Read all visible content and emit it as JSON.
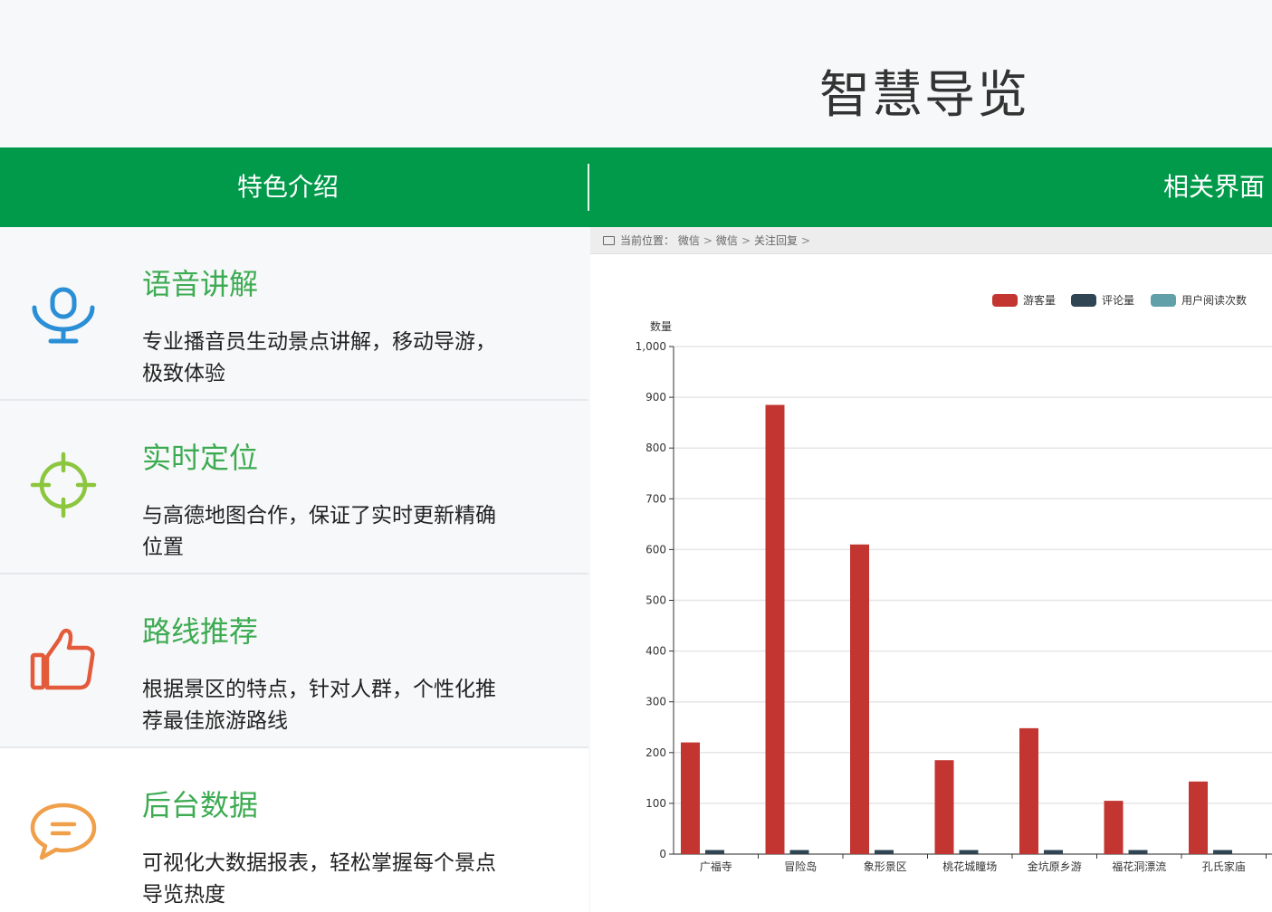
{
  "header": {
    "title": "智慧导览"
  },
  "tabs": [
    {
      "label": "特色介绍"
    },
    {
      "label": "相关界面"
    }
  ],
  "features": [
    {
      "title": "语音讲解",
      "desc": "专业播音员生动景点讲解，移动导游，极致体验",
      "icon": "microphone-icon",
      "color": "#2a8fd6"
    },
    {
      "title": "实时定位",
      "desc": "与高德地图合作，保证了实时更新精确位置",
      "icon": "crosshair-icon",
      "color": "#8cc63f"
    },
    {
      "title": "路线推荐",
      "desc": "根据景区的特点，针对人群，个性化推荐最佳旅游路线",
      "icon": "thumbs-up-icon",
      "color": "#e35b3b"
    },
    {
      "title": "后台数据",
      "desc": "可视化大数据报表，轻松掌握每个景点导览热度",
      "icon": "chat-bubble-icon",
      "color": "#f0a04b"
    }
  ],
  "breadcrumb": {
    "prefix": "当前位置：",
    "items": [
      "微信",
      "微信",
      "关注回复"
    ],
    "separator": ">"
  },
  "chart_data": {
    "type": "bar",
    "ylabel": "数量",
    "ylim": [
      0,
      1000
    ],
    "yticks": [
      0,
      100,
      200,
      300,
      400,
      500,
      600,
      700,
      800,
      900,
      1000
    ],
    "ytick_labels": [
      "0",
      "100",
      "200",
      "300",
      "400",
      "500",
      "600",
      "700",
      "800",
      "900",
      "1,000"
    ],
    "grid": true,
    "legend_position": "top-right",
    "categories": [
      "广福寺",
      "冒险岛",
      "象形景区",
      "桃花城瞳场",
      "金坑原乡游",
      "福花洞漂流",
      "孔氏家庙"
    ],
    "series": [
      {
        "name": "游客量",
        "color": "#c23531",
        "values": [
          220,
          885,
          610,
          185,
          248,
          105,
          143
        ]
      },
      {
        "name": "评论量",
        "color": "#2f4554",
        "values": [
          8,
          8,
          8,
          8,
          8,
          8,
          8
        ]
      },
      {
        "name": "用户阅读次数",
        "color": "#61a0a8",
        "values": [
          0,
          0,
          0,
          0,
          0,
          0,
          0
        ]
      }
    ]
  }
}
